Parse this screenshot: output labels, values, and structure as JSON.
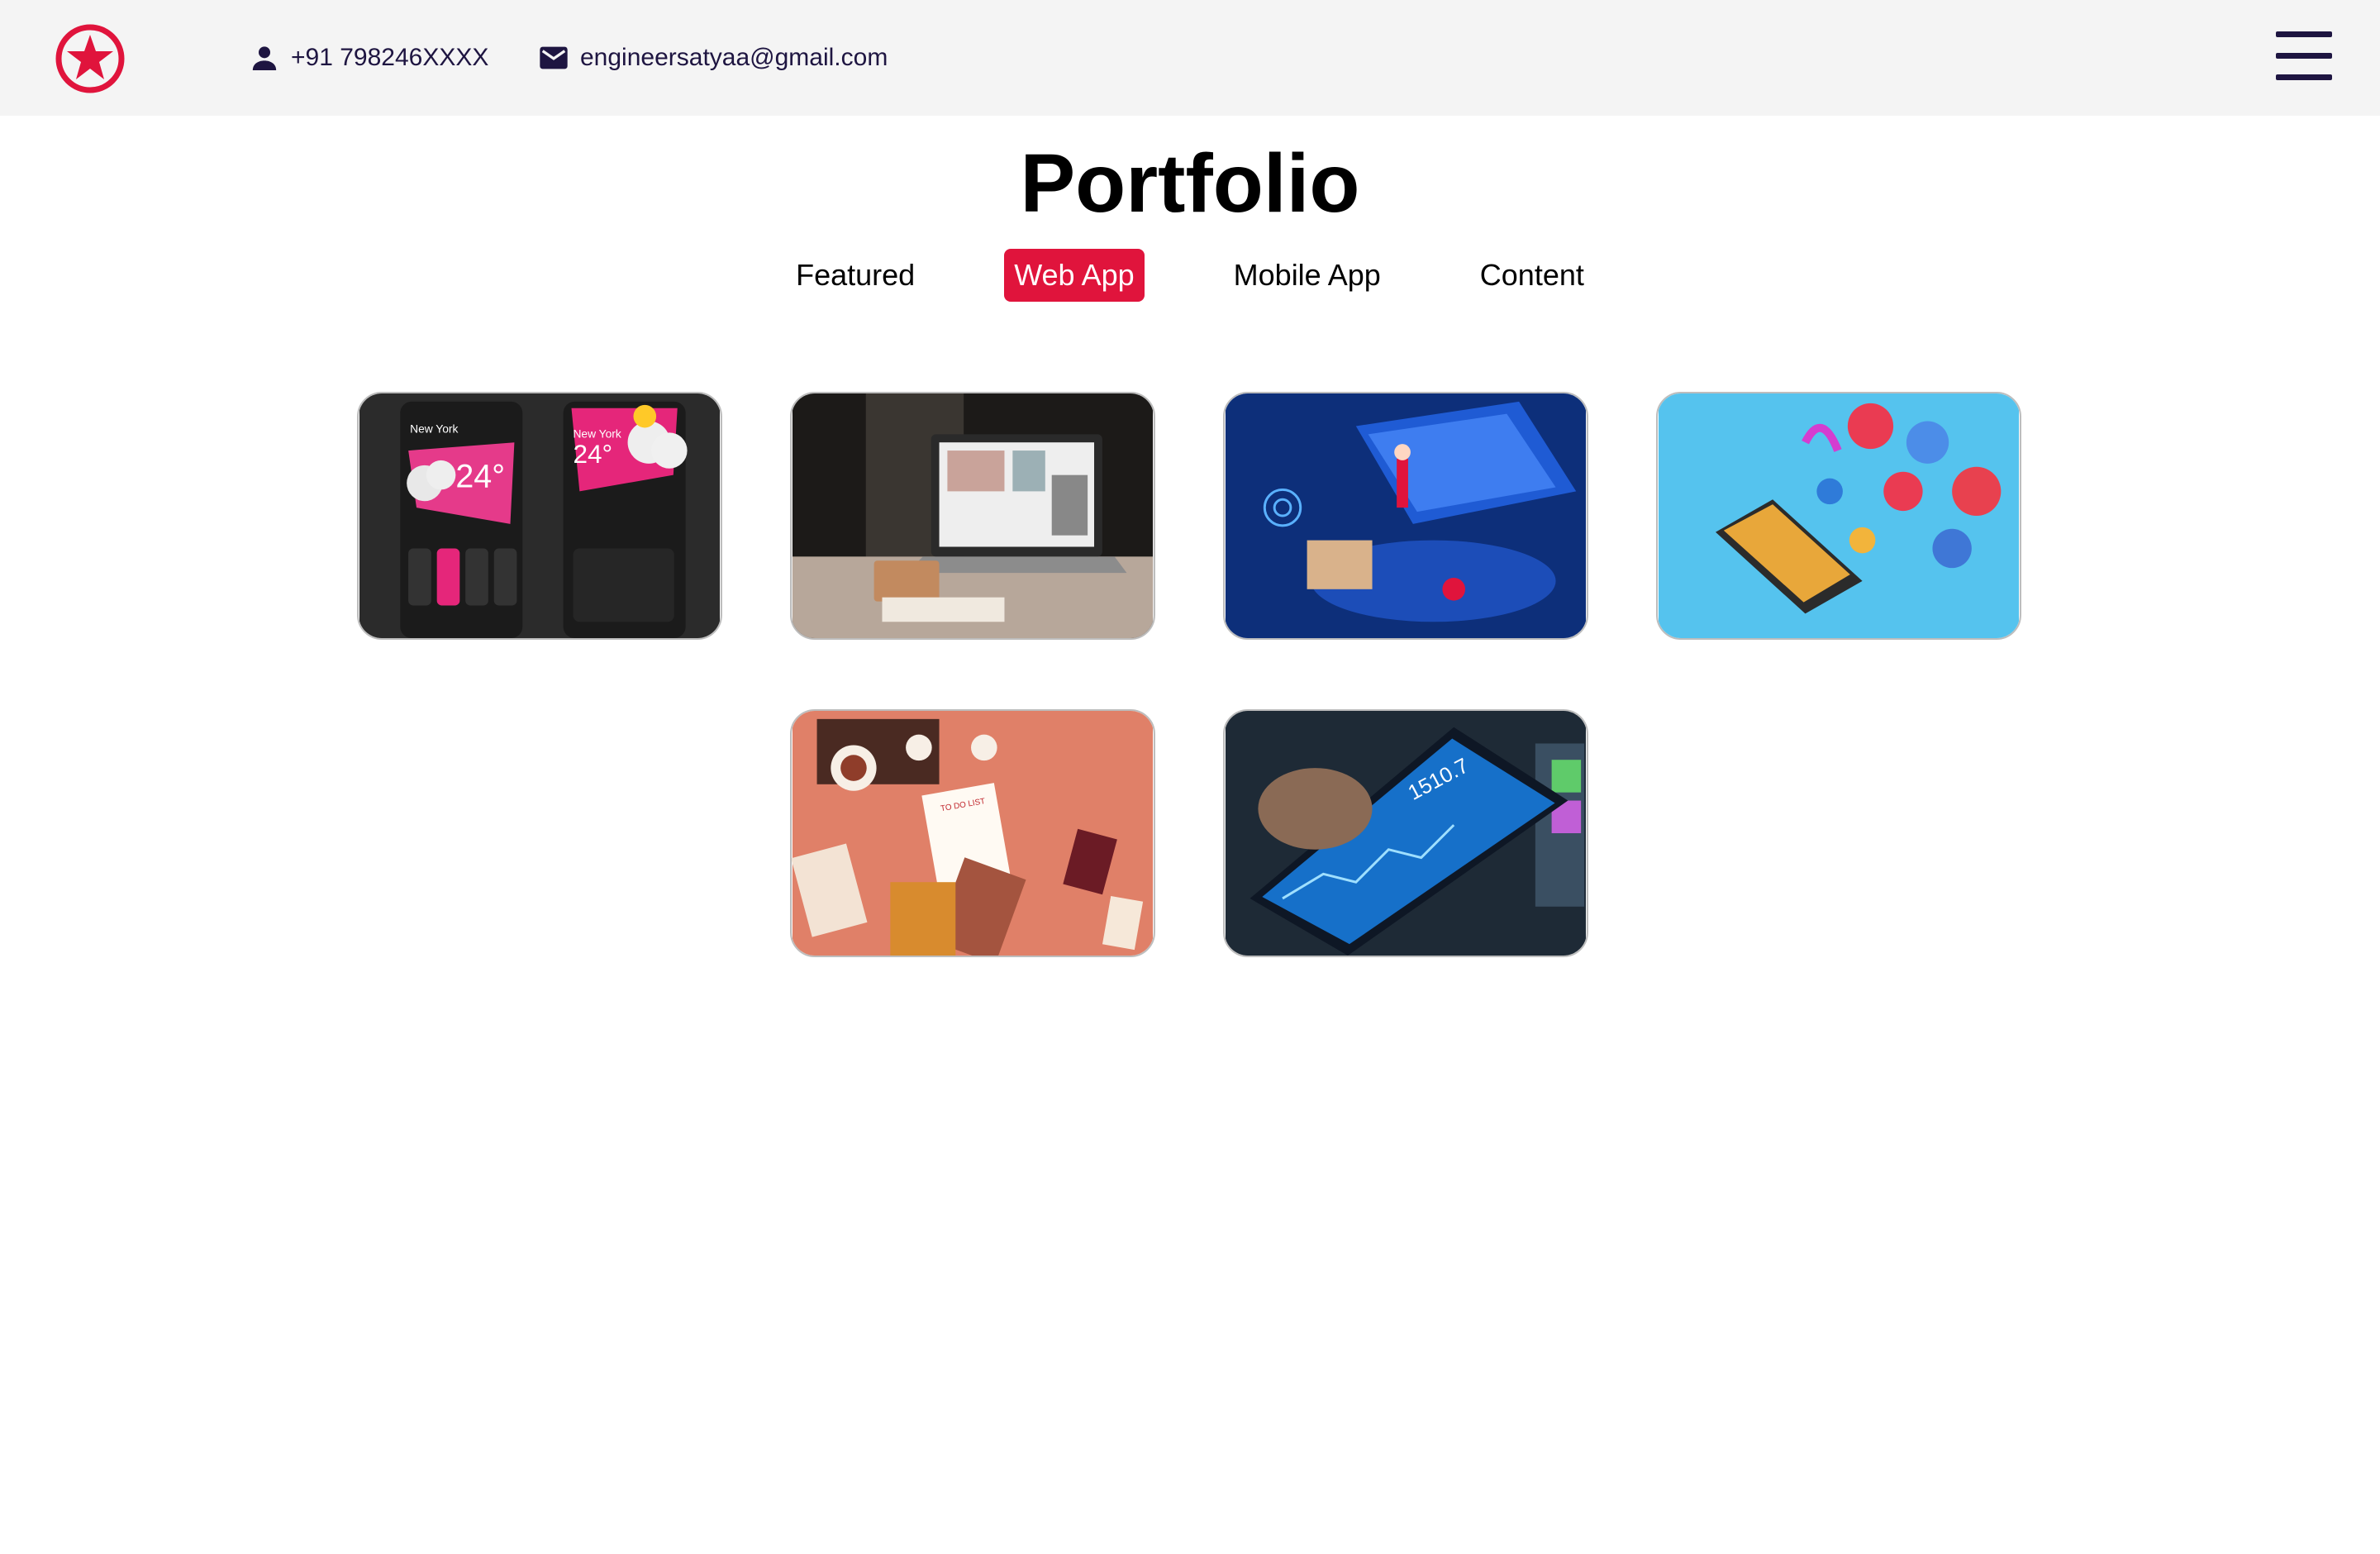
{
  "header": {
    "phone": "+91 798246XXXX",
    "email": "engineersatyaa@gmail.com",
    "accent_color": "#e0143c",
    "text_color": "#1e1541"
  },
  "page": {
    "title": "Portfolio"
  },
  "tabs": [
    {
      "label": "Featured",
      "active": false
    },
    {
      "label": "Web App",
      "active": true
    },
    {
      "label": "Mobile App",
      "active": false
    },
    {
      "label": "Content",
      "active": false
    }
  ],
  "portfolio_items": [
    {
      "image": "weather-app-screens",
      "label_city": "New York",
      "label_temp": "24°",
      "label_temp_2": "24°"
    },
    {
      "image": "laptop-on-desk"
    },
    {
      "image": "isometric-web-dashboard"
    },
    {
      "image": "social-media-laptop"
    },
    {
      "image": "to-do-list-illustration",
      "note_title": "TO DO LIST"
    },
    {
      "image": "stock-trading-phone",
      "value": "1510.7"
    }
  ]
}
